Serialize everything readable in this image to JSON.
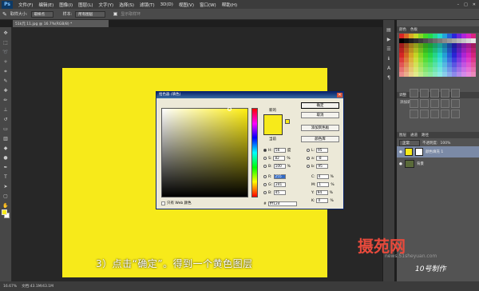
{
  "menu": {
    "logo": "Ps",
    "items": [
      "文件(F)",
      "编辑(E)",
      "图像(I)",
      "图层(L)",
      "文字(Y)",
      "选择(S)",
      "滤镜(T)",
      "3D(D)",
      "视图(V)",
      "窗口(W)",
      "帮助(H)"
    ]
  },
  "options": {
    "size_label": "取样大小:",
    "size_value": "取样点",
    "sample_label": "样本:",
    "sample_value": "所有图层",
    "show_ring": "显示取样环"
  },
  "doc": {
    "tab": "51k元 11.jpg @ 16.7%(RGB/8) *"
  },
  "picker": {
    "title": "拾色器 (填色)",
    "new_label": "新的",
    "current_label": "当前",
    "ok": "确定",
    "cancel": "取消",
    "add_swatch": "添加到色板",
    "color_lib": "颜色库",
    "h": "56",
    "h_unit": "度",
    "s": "82",
    "b": "100",
    "r": "255",
    "g": "241",
    "bl": "45",
    "l": "95",
    "a": "-8",
    "bb": "95",
    "c": "4",
    "m": "1",
    "y": "94",
    "k": "0",
    "hex": "fff12d",
    "web_only": "只有 Web 颜色"
  },
  "layers": {
    "mode": "正常",
    "opacity_label": "不透明度:",
    "opacity": "100%",
    "fill_label": "填充:",
    "fill": "100%",
    "layer1": "颜色填充 1",
    "layer2": "背景"
  },
  "panel_tabs": {
    "color": "颜色",
    "swatches": "色板",
    "adjust": "调整",
    "styles": "样式",
    "add_adjust": "添加调整",
    "layers_tab": "图层",
    "channels": "通道",
    "paths": "路径"
  },
  "status": {
    "zoom": "16.67%",
    "doc": "文档:43.1M/43.1M"
  },
  "overlay": {
    "caption": "3）点击“确定”。得到一个黄色图层",
    "brand": "摄苑网",
    "url": "news.51sheyuan.com",
    "signature": "10号制作"
  },
  "colors": {
    "accent_yellow": "#f7ea1a",
    "title_blue": "#0a246a",
    "brand_red": "#e84a3c"
  }
}
